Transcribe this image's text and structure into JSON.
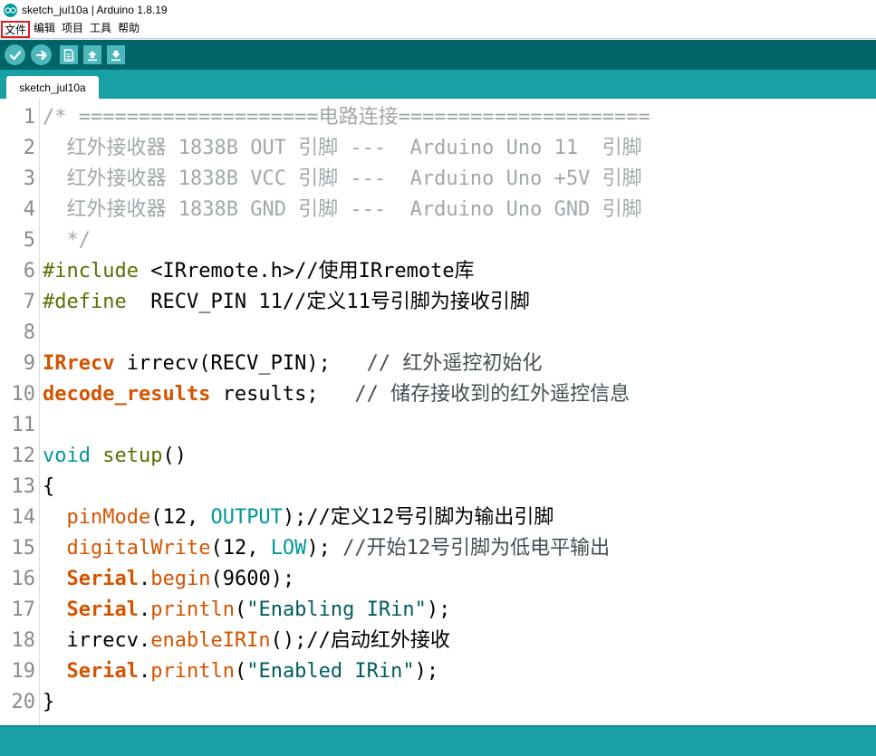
{
  "window": {
    "title": "sketch_jul10a | Arduino 1.8.19",
    "logo_icon": "arduino-logo-icon"
  },
  "menu": {
    "items": [
      "文件",
      "编辑",
      "项目",
      "工具",
      "帮助"
    ],
    "highlighted_index": 0
  },
  "toolbar": {
    "buttons": [
      "verify-check-icon",
      "upload-arrow-icon",
      "new-file-icon",
      "open-file-icon",
      "save-file-icon"
    ]
  },
  "tabs": [
    {
      "label": "sketch_jul10a"
    }
  ],
  "editor": {
    "lines": [
      {
        "n": "1",
        "parts": [
          [
            "c-comment",
            "/* ====================电路连接====================="
          ]
        ]
      },
      {
        "n": "2",
        "parts": [
          [
            "c-comment",
            "  红外接收器 1838B OUT 引脚 ---  Arduino Uno 11  引脚"
          ]
        ]
      },
      {
        "n": "3",
        "parts": [
          [
            "c-comment",
            "  红外接收器 1838B VCC 引脚 ---  Arduino Uno +5V 引脚"
          ]
        ]
      },
      {
        "n": "4",
        "parts": [
          [
            "c-comment",
            "  红外接收器 1838B GND 引脚 ---  Arduino Uno GND 引脚"
          ]
        ]
      },
      {
        "n": "5",
        "parts": [
          [
            "c-comment",
            "  */"
          ]
        ]
      },
      {
        "n": "6",
        "parts": [
          [
            "c-pre",
            "#include "
          ],
          [
            "c-dark",
            "<IRremote.h>//使用IRremote库"
          ]
        ]
      },
      {
        "n": "7",
        "parts": [
          [
            "c-pre",
            "#define "
          ],
          [
            "c-dark",
            " RECV_PIN 11//定义11号引脚为接收引脚"
          ]
        ]
      },
      {
        "n": "8",
        "parts": []
      },
      {
        "n": "9",
        "parts": [
          [
            "c-type",
            "IRrecv"
          ],
          [
            "c-dark",
            " irrecv(RECV_PIN);   "
          ],
          [
            "c-com",
            "// 红外遥控初始化"
          ]
        ]
      },
      {
        "n": "10",
        "parts": [
          [
            "c-type",
            "decode_results"
          ],
          [
            "c-dark",
            " results;   "
          ],
          [
            "c-com",
            "// 储存接收到的红外遥控信息"
          ]
        ]
      },
      {
        "n": "11",
        "parts": []
      },
      {
        "n": "12",
        "parts": [
          [
            "c-kw",
            "void"
          ],
          [
            "c-dark",
            " "
          ],
          [
            "c-fn",
            "setup"
          ],
          [
            "c-dark",
            "()"
          ]
        ]
      },
      {
        "n": "13",
        "parts": [
          [
            "c-dark",
            "{"
          ]
        ]
      },
      {
        "n": "14",
        "parts": [
          [
            "c-dark",
            "  "
          ],
          [
            "c-method",
            "pinMode"
          ],
          [
            "c-dark",
            "(12, "
          ],
          [
            "c-const",
            "OUTPUT"
          ],
          [
            "c-dark",
            ");//定义12号引脚为输出引脚"
          ]
        ]
      },
      {
        "n": "15",
        "parts": [
          [
            "c-dark",
            "  "
          ],
          [
            "c-method",
            "digitalWrite"
          ],
          [
            "c-dark",
            "(12, "
          ],
          [
            "c-const",
            "LOW"
          ],
          [
            "c-dark",
            "); "
          ],
          [
            "c-com",
            "//开始12号引脚为低电平输出"
          ]
        ]
      },
      {
        "n": "16",
        "parts": [
          [
            "c-dark",
            "  "
          ],
          [
            "c-type",
            "Serial"
          ],
          [
            "c-dark",
            "."
          ],
          [
            "c-method",
            "begin"
          ],
          [
            "c-dark",
            "(9600);"
          ]
        ]
      },
      {
        "n": "17",
        "parts": [
          [
            "c-dark",
            "  "
          ],
          [
            "c-type",
            "Serial"
          ],
          [
            "c-dark",
            "."
          ],
          [
            "c-method",
            "println"
          ],
          [
            "c-dark",
            "("
          ],
          [
            "c-str",
            "\"Enabling IRin\""
          ],
          [
            "c-dark",
            ");"
          ]
        ]
      },
      {
        "n": "18",
        "parts": [
          [
            "c-dark",
            "  irrecv."
          ],
          [
            "c-method",
            "enableIRIn"
          ],
          [
            "c-dark",
            "();//启动红外接收"
          ]
        ]
      },
      {
        "n": "19",
        "parts": [
          [
            "c-dark",
            "  "
          ],
          [
            "c-type",
            "Serial"
          ],
          [
            "c-dark",
            "."
          ],
          [
            "c-method",
            "println"
          ],
          [
            "c-dark",
            "("
          ],
          [
            "c-str",
            "\"Enabled IRin\""
          ],
          [
            "c-dark",
            ");"
          ]
        ]
      },
      {
        "n": "20",
        "parts": [
          [
            "c-dark",
            "}"
          ]
        ]
      }
    ]
  },
  "colors": {
    "toolbar_bg": "#006468",
    "tabstrip_bg": "#17a1a5",
    "button_bg": "#4db7bb",
    "highlight_border": "#e21b1b"
  }
}
